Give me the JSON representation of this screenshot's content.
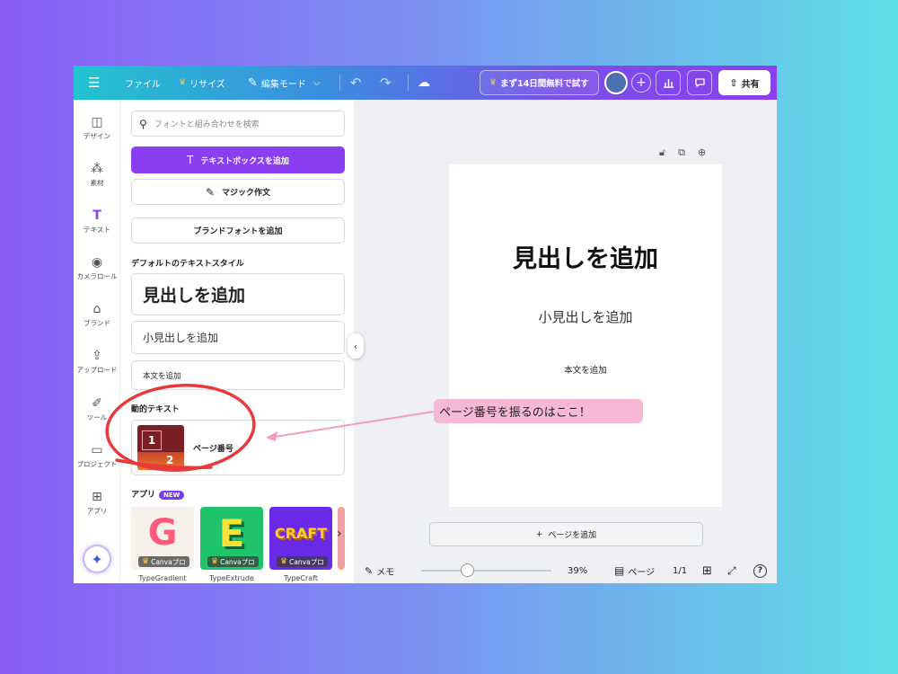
{
  "topbar": {
    "file": "ファイル",
    "resize": "リサイズ",
    "edit_mode": "編集モード",
    "trial": "まず14日間無料で試す",
    "share": "共有"
  },
  "rail": {
    "items": [
      {
        "label": "デザイン",
        "icon": "design-icon"
      },
      {
        "label": "素材",
        "icon": "elements-icon"
      },
      {
        "label": "テキスト",
        "icon": "text-icon"
      },
      {
        "label": "カメラロール",
        "icon": "camera-icon"
      },
      {
        "label": "ブランド",
        "icon": "brand-icon"
      },
      {
        "label": "アップロード",
        "icon": "upload-icon"
      },
      {
        "label": "ツール",
        "icon": "tools-icon"
      },
      {
        "label": "プロジェクト",
        "icon": "folder-icon"
      },
      {
        "label": "アプリ",
        "icon": "apps-icon"
      }
    ]
  },
  "panel": {
    "search_placeholder": "フォントと組み合わせを検索",
    "add_textbox": "テキストボックスを追加",
    "magic_write": "マジック作文",
    "brand_font": "ブランドフォントを追加",
    "default_styles_title": "デフォルトのテキストスタイル",
    "heading": "見出しを追加",
    "subheading": "小見出しを追加",
    "body": "本文を追加",
    "dynamic_title": "動的テキスト",
    "page_number": "ページ番号",
    "thumb_n1": "1",
    "thumb_n2": "2",
    "apps_title": "アプリ",
    "new_badge": "NEW",
    "apps": [
      {
        "name": "TypeGradient",
        "badge": "Canvaプロ",
        "logo": "G"
      },
      {
        "name": "TypeExtrude",
        "badge": "Canvaプロ",
        "logo": "E"
      },
      {
        "name": "TypeCraft",
        "badge": "Canvaプロ",
        "logo": "CRAFT"
      }
    ]
  },
  "canvas": {
    "heading": "見出しを追加",
    "subheading": "小見出しを追加",
    "body": "本文を追加",
    "add_page": "ページを追加"
  },
  "bottombar": {
    "memo": "メモ",
    "zoom": "39%",
    "pages_label": "ページ",
    "page_count": "1/1",
    "help": "?"
  },
  "annotation": {
    "callout": "ページ番号を振るのはここ！",
    "accent": "#e83a3a"
  },
  "colors": {
    "accent": "#8b3df0",
    "callout_bg": "#f6b8d4"
  }
}
